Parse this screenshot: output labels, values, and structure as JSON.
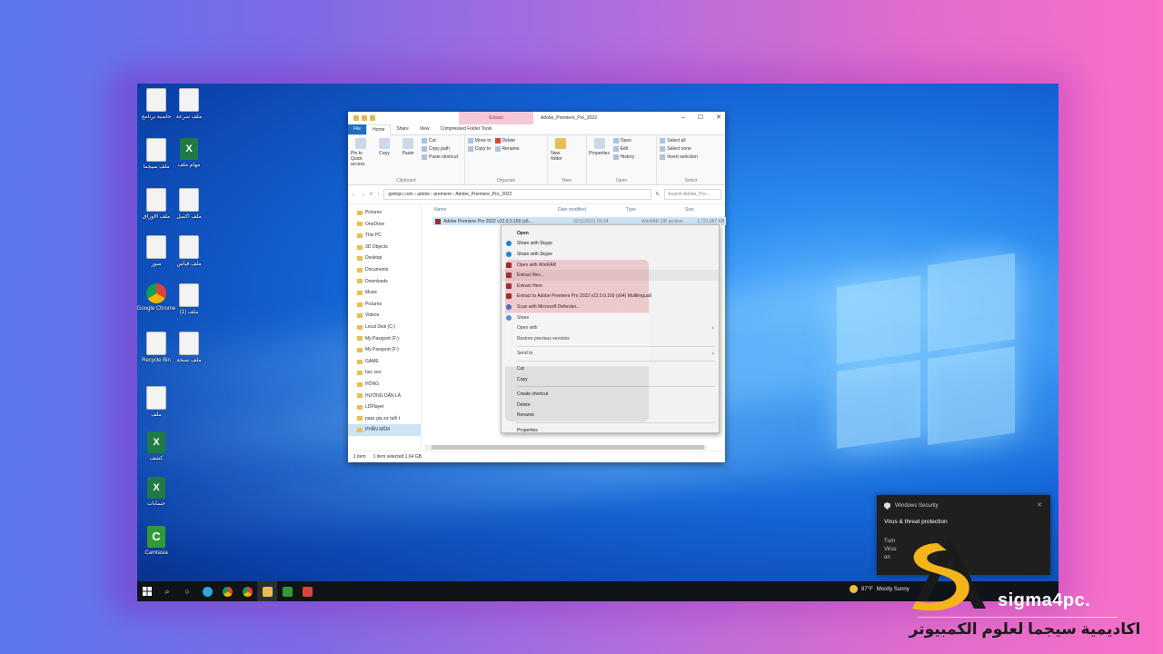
{
  "desktop": {
    "icons": [
      {
        "label": "حاسبة برنامج",
        "kind": "doc"
      },
      {
        "label": "ملف سرعة",
        "kind": "doc"
      },
      {
        "label": "ملف سيجما",
        "kind": "doc"
      },
      {
        "label": "مهام ملف",
        "kind": "xls"
      },
      {
        "label": "ملف الاوراق",
        "kind": "doc"
      },
      {
        "label": "ملف اكسل",
        "kind": "doc"
      },
      {
        "label": "صور",
        "kind": "doc"
      },
      {
        "label": "ملف قياس",
        "kind": "doc"
      },
      {
        "label": "Google Chrome",
        "kind": "chrome"
      },
      {
        "label": "ملف (1)",
        "kind": "doc"
      },
      {
        "label": "Recycle Bin",
        "kind": "doc"
      },
      {
        "label": "ملف نسخة",
        "kind": "doc"
      },
      {
        "label": "ملف",
        "kind": "doc"
      },
      {
        "label": "كشف",
        "kind": "xls"
      },
      {
        "label": "حسابات",
        "kind": "xls"
      },
      {
        "label": "Camtasia",
        "kind": "camt"
      }
    ]
  },
  "explorer": {
    "context_tab": "Extract",
    "title": "Adobe_Premiere_Pro_2022",
    "tabs": [
      "File",
      "Home",
      "Share",
      "View",
      "Compressed Folder Tools"
    ],
    "ribbon": {
      "clipboard": {
        "name": "Clipboard",
        "pin": "Pin to Quick access",
        "copy": "Copy",
        "paste": "Paste",
        "cut": "Cut",
        "copy_path": "Copy path",
        "paste_shortcut": "Paste shortcut"
      },
      "organize": {
        "name": "Organize",
        "move_to": "Move to",
        "copy_to": "Copy to",
        "delete": "Delete",
        "rename": "Rename"
      },
      "new": {
        "name": "New",
        "new_folder": "New folder"
      },
      "open": {
        "name": "Open",
        "properties": "Properties",
        "open": "Open",
        "edit": "Edit",
        "history": "History"
      },
      "select": {
        "name": "Select",
        "select_all": "Select all",
        "select_none": "Select none",
        "invert": "Invert selection"
      }
    },
    "address": {
      "crumbs": "gettopc.com › adobe › premiere › Adobe_Premiere_Pro_2022",
      "search_placeholder": "Search Adobe_Pre..."
    },
    "nav": [
      {
        "label": "Pictures",
        "selected": false
      },
      {
        "label": "OneDrive",
        "selected": false
      },
      {
        "label": "This PC",
        "selected": false
      },
      {
        "label": "3D Objects",
        "selected": false
      },
      {
        "label": "Desktop",
        "selected": false
      },
      {
        "label": "Documents",
        "selected": false
      },
      {
        "label": "Downloads",
        "selected": false
      },
      {
        "label": "Music",
        "selected": false
      },
      {
        "label": "Pictures",
        "selected": false
      },
      {
        "label": "Videos",
        "selected": false
      },
      {
        "label": "Local Disk (C:)",
        "selected": false
      },
      {
        "label": "My Passport (F:)",
        "selected": false
      },
      {
        "label": "My Passport (F:)",
        "selected": false
      },
      {
        "label": "GAME",
        "selected": false
      },
      {
        "label": "hoc seo",
        "selected": false
      },
      {
        "label": "HỒNG",
        "selected": false
      },
      {
        "label": "HƯỚNG DẪN LÀ",
        "selected": false
      },
      {
        "label": "LDPlayer",
        "selected": false
      },
      {
        "label": "pass gia sư tuổi t",
        "selected": false
      },
      {
        "label": "PHẦN MỀM",
        "selected": true
      }
    ],
    "columns": {
      "name": "Name",
      "date": "Date modified",
      "type": "Type",
      "size": "Size"
    },
    "file": {
      "name": "Adobe Premiere Pro 2022 v22.0.0.169 (x6...",
      "date": "02/11/2021 09:34",
      "type": "WinRAR ZIP archive",
      "size": "1,721,687 KB"
    },
    "status": {
      "items": "1 item",
      "selected": "1 item selected  1.64 GB"
    }
  },
  "context_menu": [
    {
      "label": "Open",
      "bold": true,
      "icon": ""
    },
    {
      "label": "Share with Skype",
      "icon": "blue"
    },
    {
      "label": "Share with Skype",
      "icon": "blue"
    },
    {
      "label": "Open with WinRAR",
      "icon": "rar"
    },
    {
      "label": "Extract files...",
      "icon": "rar",
      "highlight": true
    },
    {
      "label": "Extract Here",
      "icon": "rar"
    },
    {
      "label": "Extract to Adobe Premiere Pro 2022 v22.0.0.169 (x64) Multilingual\\",
      "icon": "rar"
    },
    {
      "label": "Scan with Microsoft Defender...",
      "icon": "blue"
    },
    {
      "label": "Share",
      "icon": "blue"
    },
    {
      "label": "Open with",
      "icon": "",
      "arrow": true
    },
    {
      "label": "Restore previous versions",
      "icon": "",
      "sep_after": true
    },
    {
      "label": "Send to",
      "icon": "",
      "arrow": true,
      "sep_after": true
    },
    {
      "label": "Cut",
      "icon": ""
    },
    {
      "label": "Copy",
      "icon": "",
      "sep_after": true
    },
    {
      "label": "Create shortcut",
      "icon": ""
    },
    {
      "label": "Delete",
      "icon": ""
    },
    {
      "label": "Rename",
      "icon": "",
      "sep_after": true
    },
    {
      "label": "Properties",
      "icon": ""
    }
  ],
  "toast": {
    "app": "Windows Security",
    "title": "Virus & threat protection",
    "body_l1": "Turn",
    "body_l2": "Virus",
    "body_l3": "on"
  },
  "taskbar": {
    "weather_temp": "87°F",
    "weather_text": "Mostly Sunny"
  },
  "branding": {
    "site": "sigma4pc.",
    "arabic": "اكاديمية سيجما لعلوم الكمبيوتر",
    "logo_color": "#f3b51b"
  }
}
